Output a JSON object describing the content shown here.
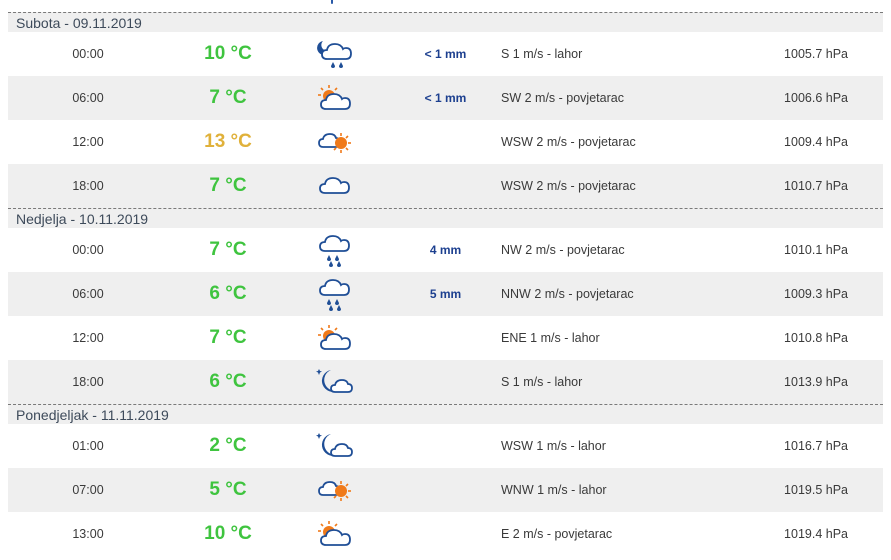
{
  "colors": {
    "temp_green": "#3fc43f",
    "temp_yellow": "#e0b13a",
    "precip_blue": "#1c3f8f"
  },
  "days": [
    {
      "label": "Subota - 09.11.2019",
      "rows": [
        {
          "time": "00:00",
          "temp": "10 °C",
          "temp_color": "green",
          "icon": "night-cloud-rain-icon",
          "precip": "< 1 mm",
          "wind": "S 1 m/s - lahor",
          "pressure": "1005.7 hPa"
        },
        {
          "time": "06:00",
          "temp": "7 °C",
          "temp_color": "green",
          "icon": "sun-cloud-icon",
          "precip": "< 1 mm",
          "wind": "SW 2 m/s - povjetarac",
          "pressure": "1006.6 hPa"
        },
        {
          "time": "12:00",
          "temp": "13 °C",
          "temp_color": "yellow",
          "icon": "cloud-sun-icon",
          "precip": "",
          "wind": "WSW 2 m/s - povjetarac",
          "pressure": "1009.4 hPa"
        },
        {
          "time": "18:00",
          "temp": "7 °C",
          "temp_color": "green",
          "icon": "cloud-icon",
          "precip": "",
          "wind": "WSW 2 m/s - povjetarac",
          "pressure": "1010.7 hPa"
        }
      ]
    },
    {
      "label": "Nedjelja - 10.11.2019",
      "rows": [
        {
          "time": "00:00",
          "temp": "7 °C",
          "temp_color": "green",
          "icon": "cloud-rain-icon",
          "precip": "4 mm",
          "wind": "NW 2 m/s - povjetarac",
          "pressure": "1010.1 hPa"
        },
        {
          "time": "06:00",
          "temp": "6 °C",
          "temp_color": "green",
          "icon": "cloud-rain-icon",
          "precip": "5 mm",
          "wind": "NNW 2 m/s - povjetarac",
          "pressure": "1009.3 hPa"
        },
        {
          "time": "12:00",
          "temp": "7 °C",
          "temp_color": "green",
          "icon": "sun-cloud-icon",
          "precip": "",
          "wind": "ENE 1 m/s - lahor",
          "pressure": "1010.8 hPa"
        },
        {
          "time": "18:00",
          "temp": "6 °C",
          "temp_color": "green",
          "icon": "night-cloud-icon",
          "precip": "",
          "wind": "S 1 m/s - lahor",
          "pressure": "1013.9 hPa"
        }
      ]
    },
    {
      "label": "Ponedjeljak - 11.11.2019",
      "rows": [
        {
          "time": "01:00",
          "temp": "2 °C",
          "temp_color": "green",
          "icon": "night-cloud-icon",
          "precip": "",
          "wind": "WSW 1 m/s - lahor",
          "pressure": "1016.7 hPa"
        },
        {
          "time": "07:00",
          "temp": "5 °C",
          "temp_color": "green",
          "icon": "cloud-sun-icon",
          "precip": "",
          "wind": "WNW 1 m/s - lahor",
          "pressure": "1019.5 hPa"
        },
        {
          "time": "13:00",
          "temp": "10 °C",
          "temp_color": "green",
          "icon": "sun-cloud-icon",
          "precip": "",
          "wind": "E 2 m/s - povjetarac",
          "pressure": "1019.4 hPa"
        }
      ]
    }
  ]
}
